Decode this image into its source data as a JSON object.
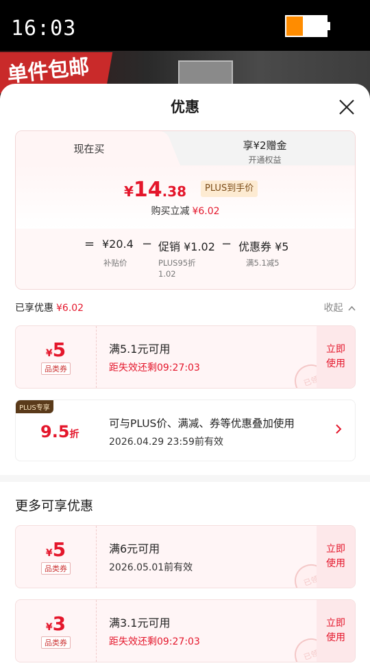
{
  "status_bar": {
    "time": "16:03",
    "battery_level": 0.42,
    "battery_color": "#ff8c00"
  },
  "background": {
    "promo_text": "单件包邮"
  },
  "sheet": {
    "title": "优惠"
  },
  "price_card": {
    "tab_active": "现在买",
    "tab_inactive_title": "享¥2赠金",
    "tab_inactive_sub": "开通权益",
    "yen": "¥",
    "price_int": "14",
    "price_dec": ".38",
    "plus_tag": "PLUS到手价",
    "save_label": "购买立减",
    "save_amount": "¥6.02",
    "breakdown": {
      "eq": "=",
      "base_value": "¥20.4",
      "base_label": "补贴价",
      "minus1": "−",
      "promo_value": "促销 ¥1.02",
      "promo_label1": "PLUS95折",
      "promo_label2": "1.02",
      "minus2": "−",
      "coupon_value": "优惠券 ¥5",
      "coupon_label": "满5.1减5"
    }
  },
  "enjoyed": {
    "label": "已享优惠",
    "amount": "¥6.02",
    "collapse": "收起"
  },
  "coupons_enjoyed": [
    {
      "yen": "¥",
      "amount": "5",
      "kind": "品类券",
      "condition": "满5.1元可用",
      "expiry": "距失效还剩09:27:03",
      "expiry_color": "#e4162b",
      "action_line1": "立即",
      "action_line2": "使用",
      "stamp": "已领"
    }
  ],
  "plus_card": {
    "badge": "PLUS专享",
    "discount_num": "9.5",
    "discount_unit": "折",
    "desc": "可与PLUS价、满减、券等优惠叠加使用",
    "expiry": "2026.04.29 23:59前有效"
  },
  "more_section": {
    "title": "更多可享优惠"
  },
  "coupons_more": [
    {
      "yen": "¥",
      "amount": "5",
      "kind": "品类券",
      "condition": "满6元可用",
      "expiry": "2026.05.01前有效",
      "expiry_color": "#333333",
      "action_line1": "立即",
      "action_line2": "使用",
      "stamp": "已领"
    },
    {
      "yen": "¥",
      "amount": "3",
      "kind": "品类券",
      "condition": "满3.1元可用",
      "expiry": "距失效还剩09:27:03",
      "expiry_color": "#e4162b",
      "action_line1": "立即",
      "action_line2": "使用",
      "stamp": "已领"
    }
  ],
  "colors": {
    "accent": "#e4162b",
    "plus_gold": "#fdebd2"
  }
}
